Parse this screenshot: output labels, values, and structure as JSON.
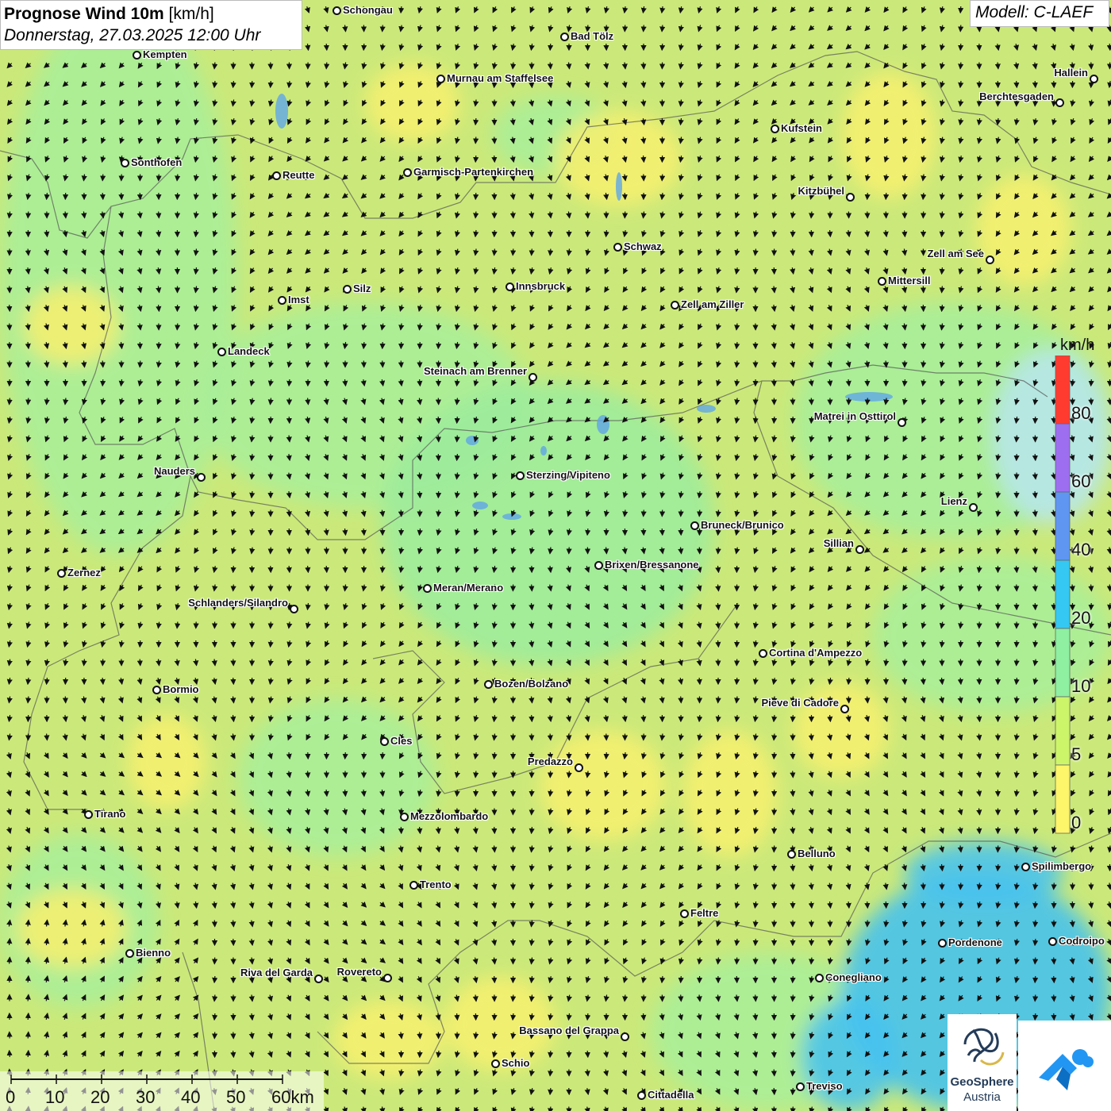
{
  "title": {
    "main": "Prognose Wind 10m",
    "unit": "[km/h]",
    "date": "Donnerstag, 27.03.2025 12:00 Uhr"
  },
  "model": "Modell: C-LAEF",
  "legend": {
    "unit": "km/h",
    "ticks": [
      "80",
      "60",
      "40",
      "20",
      "10",
      "5",
      "0"
    ],
    "colors": [
      "#ff3b30",
      "#9e6ef0",
      "#5f96f2",
      "#35c8f2",
      "#8ef0a0",
      "#cdf56a",
      "#fdf56a"
    ]
  },
  "scalebar": {
    "labels": [
      "0",
      "10",
      "20",
      "30",
      "40",
      "50",
      "60km"
    ]
  },
  "logos": {
    "geosphere_line1": "GeoSphere",
    "geosphere_line2": "Austria"
  },
  "cities": [
    {
      "name": "Schongau",
      "label_side": "right"
    },
    {
      "name": "Kempten",
      "label_side": "right"
    },
    {
      "name": "Bad Tölz",
      "label_side": "right"
    },
    {
      "name": "Murnau am Staffelsee",
      "label_side": "right"
    },
    {
      "name": "Hallein",
      "label_side": "left"
    },
    {
      "name": "Berchtesgaden",
      "label_side": "left"
    },
    {
      "name": "Kufstein",
      "label_side": "right"
    },
    {
      "name": "Sonthofen",
      "label_side": "right"
    },
    {
      "name": "Reutte",
      "label_side": "right"
    },
    {
      "name": "Garmisch-Partenkirchen",
      "label_side": "right"
    },
    {
      "name": "Kitzbühel",
      "label_side": "left"
    },
    {
      "name": "Schwaz",
      "label_side": "right"
    },
    {
      "name": "Zell am See",
      "label_side": "left"
    },
    {
      "name": "Mittersill",
      "label_side": "right"
    },
    {
      "name": "Innsbruck",
      "label_side": "right"
    },
    {
      "name": "Imst",
      "label_side": "right"
    },
    {
      "name": "Silz",
      "label_side": "right"
    },
    {
      "name": "Zell am Ziller",
      "label_side": "right"
    },
    {
      "name": "Landeck",
      "label_side": "right"
    },
    {
      "name": "Steinach am Brenner",
      "label_side": "left"
    },
    {
      "name": "Matrei in Osttirol",
      "label_side": "left"
    },
    {
      "name": "Nauders",
      "label_side": "left"
    },
    {
      "name": "Sterzing/Vipiteno",
      "label_side": "right"
    },
    {
      "name": "Lienz",
      "label_side": "left"
    },
    {
      "name": "Bruneck/Brunico",
      "label_side": "right"
    },
    {
      "name": "Sillian",
      "label_side": "left"
    },
    {
      "name": "Brixen/Bressanone",
      "label_side": "right"
    },
    {
      "name": "Zernez",
      "label_side": "right"
    },
    {
      "name": "Meran/Merano",
      "label_side": "right"
    },
    {
      "name": "Schlanders/Silandro",
      "label_side": "left"
    },
    {
      "name": "Cortina d'Ampezzo",
      "label_side": "right"
    },
    {
      "name": "Bozen/Bolzano",
      "label_side": "right"
    },
    {
      "name": "Bormio",
      "label_side": "right"
    },
    {
      "name": "Pieve di Cadore",
      "label_side": "left"
    },
    {
      "name": "Cles",
      "label_side": "right"
    },
    {
      "name": "Predazzo",
      "label_side": "left"
    },
    {
      "name": "Tirano",
      "label_side": "right"
    },
    {
      "name": "Mezzolombardo",
      "label_side": "right"
    },
    {
      "name": "Belluno",
      "label_side": "right"
    },
    {
      "name": "Spilimbergo",
      "label_side": "right"
    },
    {
      "name": "Trento",
      "label_side": "right"
    },
    {
      "name": "Feltre",
      "label_side": "right"
    },
    {
      "name": "Pordenone",
      "label_side": "right"
    },
    {
      "name": "Codroipo",
      "label_side": "right"
    },
    {
      "name": "Bienno",
      "label_side": "right"
    },
    {
      "name": "Riva del Garda",
      "label_side": "left"
    },
    {
      "name": "Rovereto",
      "label_side": "left"
    },
    {
      "name": "Conegliano",
      "label_side": "right"
    },
    {
      "name": "Bassano del Grappa",
      "label_side": "left"
    },
    {
      "name": "Schio",
      "label_side": "right"
    },
    {
      "name": "Treviso",
      "label_side": "right"
    },
    {
      "name": "Cittadella",
      "label_side": "right"
    }
  ]
}
